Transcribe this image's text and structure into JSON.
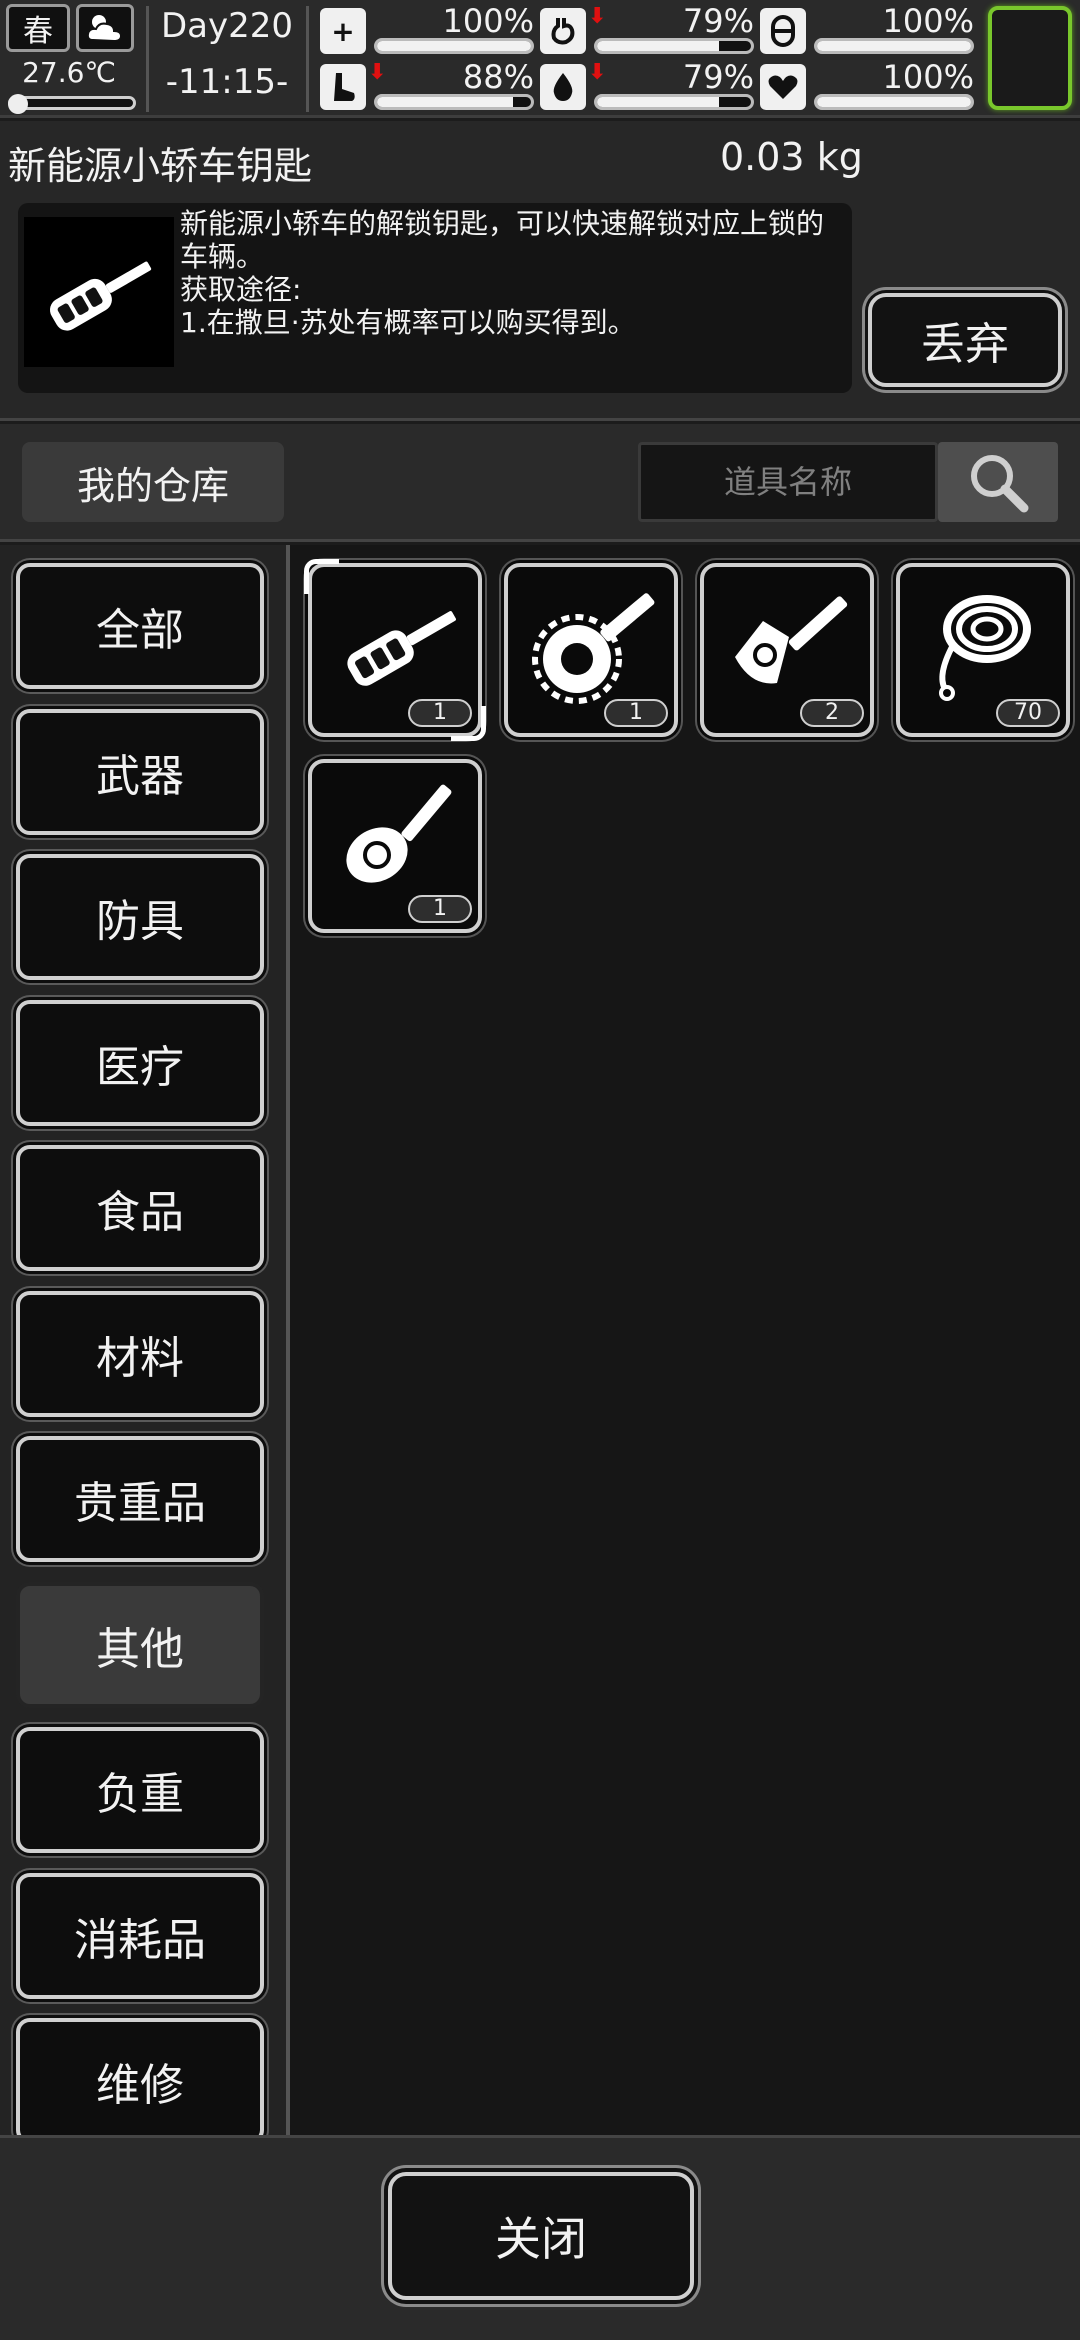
{
  "status": {
    "season": "春",
    "temperature": "27.6℃",
    "day": "Day220",
    "time": "-11:15-",
    "stats": [
      {
        "icon": "health-kit-icon",
        "value": "100%",
        "level": 1.0,
        "decreasing": false
      },
      {
        "icon": "stomach-icon",
        "value": "79%",
        "level": 0.79,
        "decreasing": true
      },
      {
        "icon": "pill-icon",
        "value": "100%",
        "level": 1.0,
        "decreasing": false
      },
      {
        "icon": "foot-icon",
        "value": "88%",
        "level": 0.88,
        "decreasing": true
      },
      {
        "icon": "water-drop-icon",
        "value": "79%",
        "level": 0.79,
        "decreasing": true
      },
      {
        "icon": "heart-icon",
        "value": "100%",
        "level": 1.0,
        "decreasing": false
      }
    ]
  },
  "detail": {
    "name": "新能源小轿车钥匙",
    "weight": "0.03 kg",
    "description": "新能源小轿车的解锁钥匙，可以快速解锁对应上锁的车辆。\n获取途径:\n1.在撒旦·苏处有概率可以购买得到。",
    "drop_label": "丢弃"
  },
  "warehouse": {
    "label": "我的仓库",
    "search_placeholder": "道具名称"
  },
  "categories": [
    "全部",
    "武器",
    "防具",
    "医疗",
    "食品",
    "材料",
    "贵重品",
    "其他",
    "负重",
    "消耗品",
    "维修"
  ],
  "active_category": "其他",
  "items": [
    {
      "icon": "car-remote-key-icon",
      "qty": "1",
      "selected": true
    },
    {
      "icon": "gear-key-icon",
      "qty": "1",
      "selected": false
    },
    {
      "icon": "motorcycle-key-icon",
      "qty": "2",
      "selected": false
    },
    {
      "icon": "rope-icon",
      "qty": "70",
      "selected": false
    },
    {
      "icon": "car-key-icon",
      "qty": "1",
      "selected": false
    }
  ],
  "footer": {
    "close_label": "关闭"
  },
  "colors": {
    "accent_green": "#79c72c",
    "alert_red": "#e01010"
  }
}
